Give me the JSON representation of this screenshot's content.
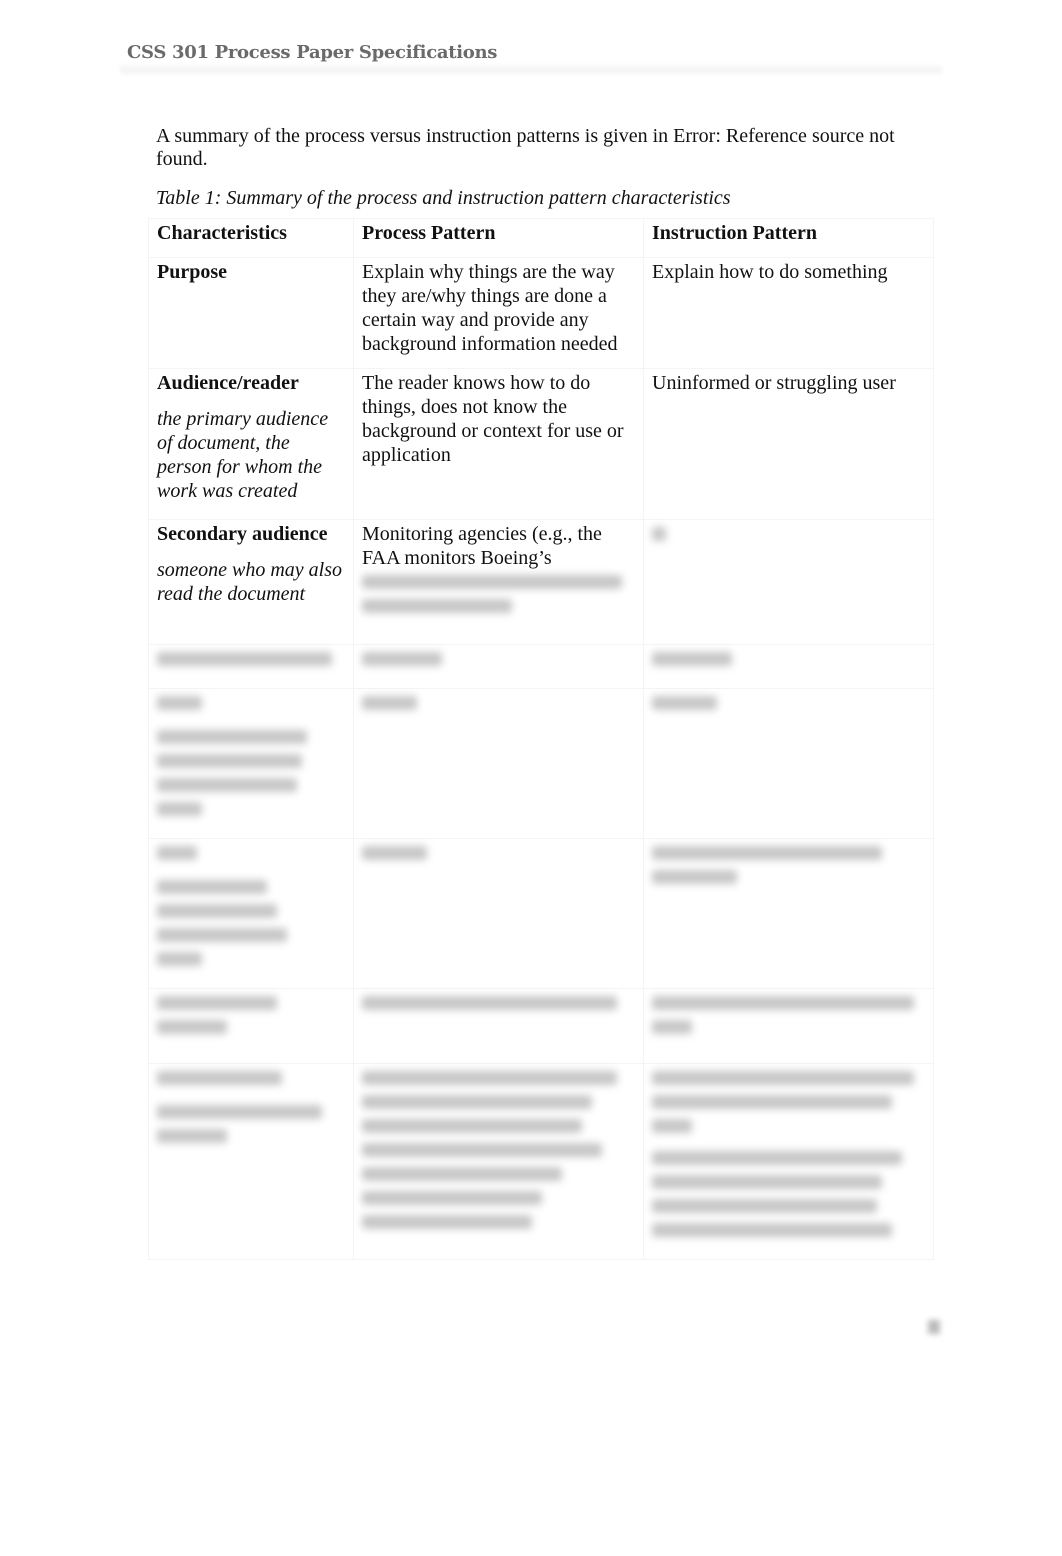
{
  "header": {
    "title": "CSS 301 Process Paper Specifications"
  },
  "body": {
    "intro": "A summary of the process versus instruction patterns is given in Error: Reference source not found.",
    "table_caption": "Table 1: Summary of the process and instruction pattern characteristics"
  },
  "table": {
    "headers": [
      "Characteristics",
      "Process Pattern",
      "Instruction Pattern"
    ],
    "rows": [
      {
        "label": "Purpose",
        "sub": "",
        "process": "Explain why things are the way they are/why things are done a certain way and provide any background information needed",
        "instruction": "Explain how to do something"
      },
      {
        "label": "Audience/reader",
        "sub": "the primary audience of document, the person for whom the work was created",
        "process": "The reader knows how to do things, does not know the background or context for use or application",
        "instruction": "Uninformed or struggling user"
      },
      {
        "label": "Secondary audience",
        "sub": "someone who may also read the document",
        "process": "Monitoring agencies (e.g., the FAA monitors Boeing’s",
        "instruction": ""
      }
    ]
  }
}
